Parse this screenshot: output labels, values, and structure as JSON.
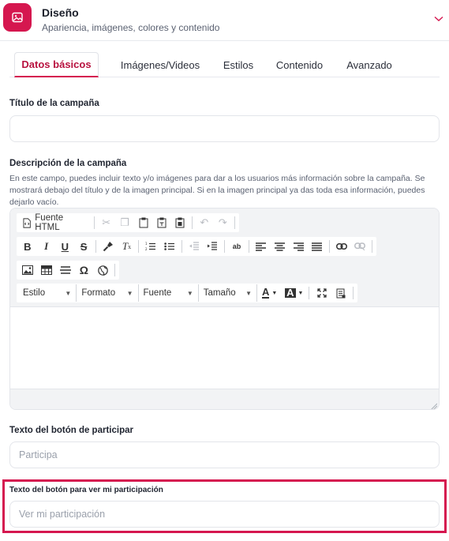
{
  "header": {
    "title": "Diseño",
    "subtitle": "Apariencia, imágenes, colores y contenido",
    "badge_icon": "image-icon",
    "chevron_icon": "chevron-down-icon"
  },
  "tabs": [
    {
      "label": "Datos básicos",
      "active": true
    },
    {
      "label": "Imágenes/Videos",
      "active": false
    },
    {
      "label": "Estilos",
      "active": false
    },
    {
      "label": "Contenido",
      "active": false
    },
    {
      "label": "Avanzado",
      "active": false
    }
  ],
  "campaign_title": {
    "label": "Título de la campaña",
    "value": "",
    "placeholder": ""
  },
  "campaign_description": {
    "label": "Descripción de la campaña",
    "help": "En este campo, puedes incluir texto y/o imágenes para dar a los usuarios más información sobre la campaña. Se mostrará debajo del título y de la imagen principal. Si en la imagen principal ya das toda esa información, puedes dejarlo vacío.",
    "editor": {
      "source_label": "Fuente HTML",
      "combos": [
        "Estilo",
        "Formato",
        "Fuente",
        "Tamaño"
      ],
      "content": ""
    }
  },
  "participate_button": {
    "label": "Texto del botón de participar",
    "placeholder": "Participa",
    "value": ""
  },
  "view_participation_button": {
    "label": "Texto del botón para ver mi participación",
    "placeholder": "Ver mi participación",
    "value": ""
  },
  "colors": {
    "accent": "#d5174f",
    "border": "#e3e5ea",
    "muted_text": "#5b6272"
  }
}
